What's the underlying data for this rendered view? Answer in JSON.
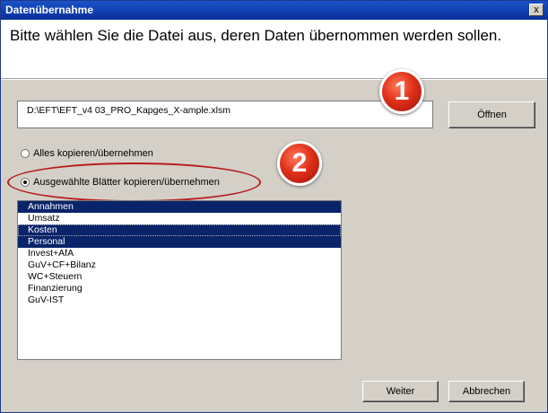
{
  "window": {
    "title": "Datenübernahme",
    "close_glyph": "x"
  },
  "header": {
    "instruction": "Bitte wählen Sie die Datei aus, deren Daten übernommen werden sollen."
  },
  "file": {
    "path": "D:\\EFT\\EFT_v4 03_PRO_Kapges_X-ample.xlsm",
    "open_label": "Öffnen"
  },
  "options": {
    "all_label": "Alles kopieren/übernehmen",
    "selected_label": "Ausgewählte Blätter kopieren/übernehmen",
    "selected_option": "selected"
  },
  "badges": {
    "one": "1",
    "two": "2",
    "color": "#e0311a"
  },
  "sheets": [
    {
      "label": "Annahmen",
      "selected": true
    },
    {
      "label": "Umsatz",
      "selected": false
    },
    {
      "label": "Kosten",
      "selected": true
    },
    {
      "label": "Personal",
      "selected": true
    },
    {
      "label": "Invest+AfA",
      "selected": false
    },
    {
      "label": "GuV+CF+Bilanz",
      "selected": false
    },
    {
      "label": "WC+Steuern",
      "selected": false
    },
    {
      "label": "Finanzierung",
      "selected": false
    },
    {
      "label": "GuV-IST",
      "selected": false
    }
  ],
  "footer": {
    "next_label": "Weiter",
    "cancel_label": "Abbrechen"
  },
  "colors": {
    "titlebar": "#0a2f9a",
    "selection": "#0a246a",
    "dialog": "#d4d0c8"
  }
}
